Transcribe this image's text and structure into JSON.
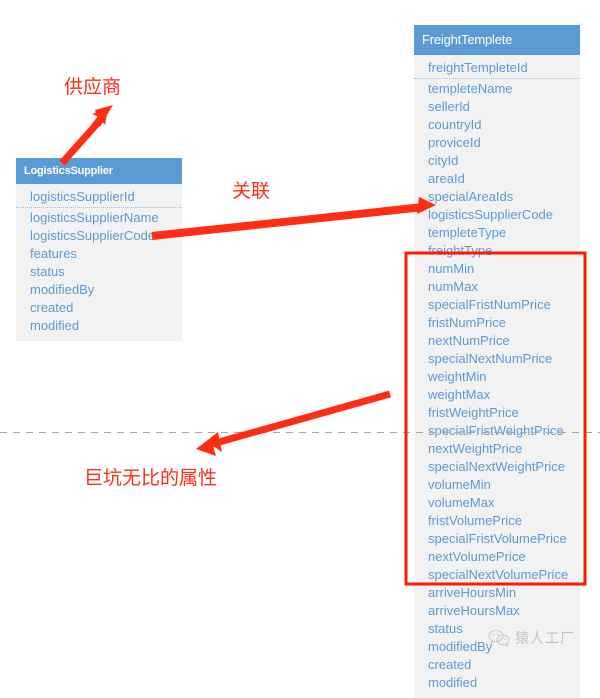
{
  "diagram": {
    "type": "er-class-diagram",
    "colors": {
      "header_blue": "#5b9bd5",
      "field_blue": "#5b9bd5",
      "panel_gray": "#f2f2f2",
      "annotation_red": "#ff2d13",
      "divider_gray": "#b0b0b0"
    }
  },
  "supplier_table": {
    "title": "LogisticsSupplier",
    "primary_key": "logisticsSupplierId",
    "fields": [
      "logisticsSupplierName",
      "logisticsSupplierCode",
      "features",
      "status",
      "modifiedBy",
      "created",
      "modified"
    ]
  },
  "freight_table": {
    "title": "FreightTemplete",
    "primary_key": "freightTempleteId",
    "fields": [
      "templeteName",
      "sellerId",
      "countryId",
      "proviceId",
      "cityId",
      "areaId",
      "specialAreaIds",
      "logisticsSupplierCode",
      "templeteType",
      "freightType",
      "numMin",
      "numMax",
      "specialFristNumPrice",
      "fristNumPrice",
      "nextNumPrice",
      "specialNextNumPrice",
      "weightMin",
      "weightMax",
      "fristWeightPrice",
      "specialFristWeightPrice",
      "nextWeightPrice",
      "specialNextWeightPrice",
      "volumeMin",
      "volumeMax",
      "fristVolumePrice",
      "specialFristVolumePrice",
      "nextVolumePrice",
      "specialNextVolumePrice",
      "arriveHoursMin",
      "arriveHoursMax",
      "status",
      "modifiedBy",
      "created",
      "modified"
    ]
  },
  "annotations": {
    "supplier_label": "供应商",
    "relation_label": "关联",
    "attributes_label": "巨坑无比的属性"
  },
  "watermark": {
    "text": "猿人工厂"
  }
}
